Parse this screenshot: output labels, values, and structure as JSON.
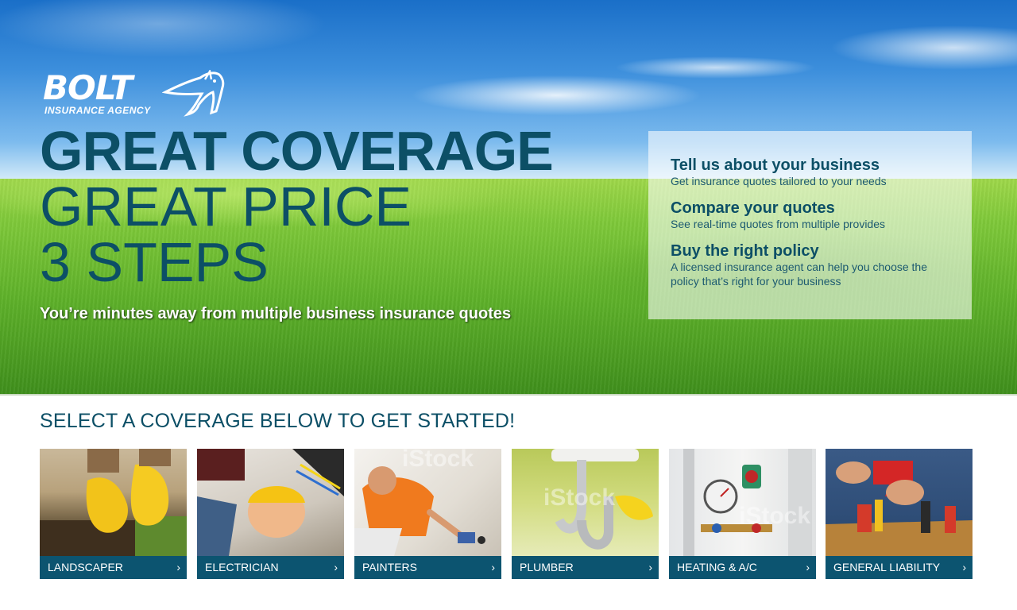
{
  "brand": {
    "logo_word": "BOLT",
    "logo_sub": "INSURANCE AGENCY"
  },
  "hero": {
    "headline_1": "GREAT COVERAGE",
    "headline_2": "GREAT PRICE",
    "headline_3": "3 STEPS",
    "tagline": "You’re minutes away from multiple business insurance quotes"
  },
  "steps": [
    {
      "title": "Tell us about your business",
      "desc": "Get insurance quotes tailored to your needs"
    },
    {
      "title": "Compare your quotes",
      "desc": "See real-time quotes from multiple provides"
    },
    {
      "title": "Buy the right policy",
      "desc": "A licensed insurance agent can help you choose the policy that’s right for your business"
    }
  ],
  "coverage": {
    "heading": "SELECT A COVERAGE BELOW TO GET STARTED!",
    "chevron": "›",
    "tiles": [
      {
        "label": "LANDSCAPER",
        "icon": "gloved-hands-sod-photo"
      },
      {
        "label": "ELECTRICIAN",
        "icon": "electrician-hardhat-photo"
      },
      {
        "label": "PAINTERS",
        "icon": "painter-wall-photo"
      },
      {
        "label": "PLUMBER",
        "icon": "sink-pipes-photo"
      },
      {
        "label": "HEATING & A/C",
        "icon": "boiler-gauge-photo"
      },
      {
        "label": "GENERAL LIABILITY",
        "icon": "tool-belt-drill-photo"
      }
    ],
    "watermark": "iStock"
  },
  "colors": {
    "brand_teal": "#0c4f66",
    "tile_bar": "#0c5470"
  }
}
